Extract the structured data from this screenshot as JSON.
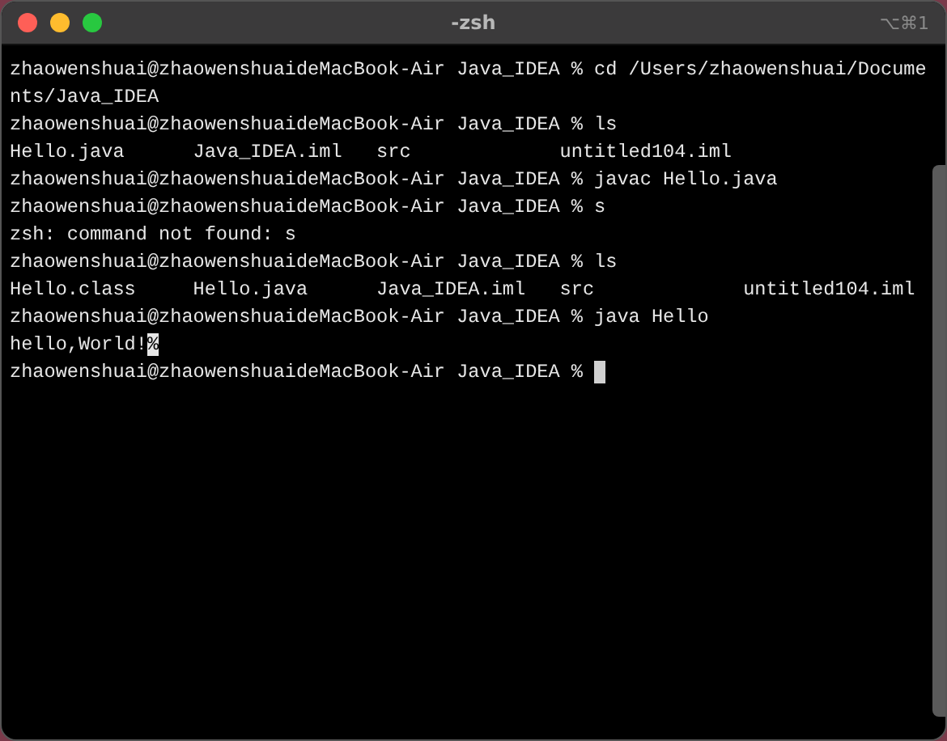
{
  "window": {
    "title": "-zsh",
    "shortcut": "⌥⌘1"
  },
  "lines": [
    {
      "text": "zhaowenshuai@zhaowenshuaideMacBook-Air Java_IDEA % cd /Users/zhaowenshuai/Docume",
      "cursor": false
    },
    {
      "text": "nts/Java_IDEA",
      "cursor": false
    },
    {
      "text": "zhaowenshuai@zhaowenshuaideMacBook-Air Java_IDEA % ls",
      "cursor": false
    },
    {
      "text": "Hello.java      Java_IDEA.iml   src             untitled104.iml",
      "cursor": false
    },
    {
      "text": "zhaowenshuai@zhaowenshuaideMacBook-Air Java_IDEA % javac Hello.java",
      "cursor": false
    },
    {
      "text": "zhaowenshuai@zhaowenshuaideMacBook-Air Java_IDEA % s",
      "cursor": false
    },
    {
      "text": "zsh: command not found: s",
      "cursor": false
    },
    {
      "text": "zhaowenshuai@zhaowenshuaideMacBook-Air Java_IDEA % ls",
      "cursor": false
    },
    {
      "text": "Hello.class     Hello.java      Java_IDEA.iml   src             untitled104.iml",
      "cursor": false
    },
    {
      "text": "zhaowenshuai@zhaowenshuaideMacBook-Air Java_IDEA % java Hello",
      "cursor": false
    },
    {
      "text": "hello,World!",
      "inverse_tail": "%",
      "cursor": false
    },
    {
      "text": "zhaowenshuai@zhaowenshuaideMacBook-Air Java_IDEA % ",
      "cursor": true
    }
  ]
}
